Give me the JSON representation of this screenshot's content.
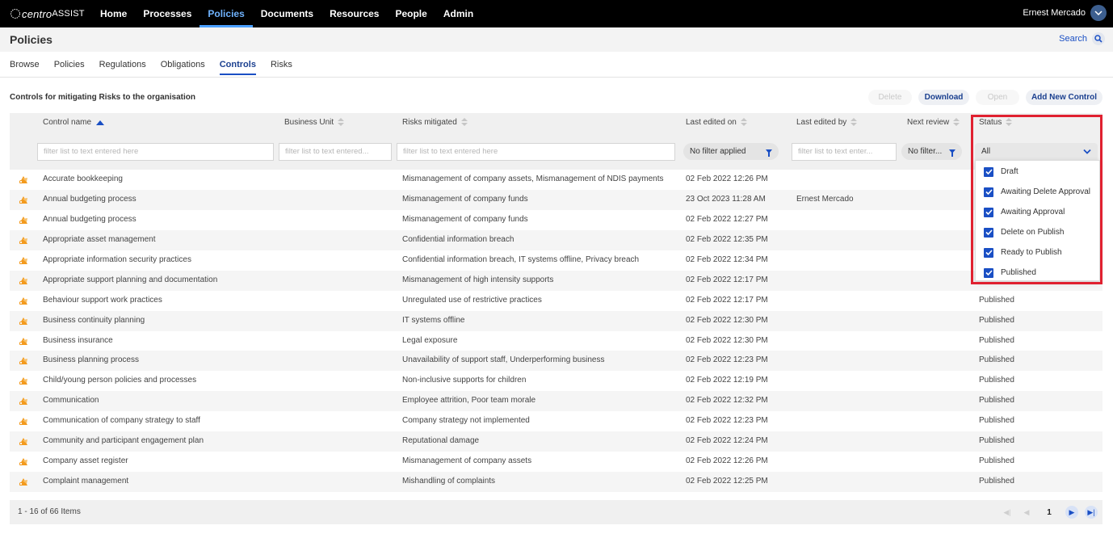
{
  "topnav": {
    "logo_prefix": "centro",
    "logo_suffix": "ASSIST",
    "items": [
      {
        "label": "Home",
        "active": false
      },
      {
        "label": "Processes",
        "active": false
      },
      {
        "label": "Policies",
        "active": true
      },
      {
        "label": "Documents",
        "active": false
      },
      {
        "label": "Resources",
        "active": false
      },
      {
        "label": "People",
        "active": false
      },
      {
        "label": "Admin",
        "active": false
      }
    ],
    "user_name": "Ernest Mercado"
  },
  "page": {
    "title": "Policies",
    "search_label": "Search"
  },
  "subtabs": [
    {
      "label": "Browse",
      "active": false
    },
    {
      "label": "Policies",
      "active": false
    },
    {
      "label": "Regulations",
      "active": false
    },
    {
      "label": "Obligations",
      "active": false
    },
    {
      "label": "Controls",
      "active": true
    },
    {
      "label": "Risks",
      "active": false
    }
  ],
  "toolbar": {
    "caption": "Controls for mitigating Risks to the organisation",
    "delete_label": "Delete",
    "download_label": "Download",
    "open_label": "Open",
    "add_label": "Add New Control"
  },
  "grid": {
    "columns": {
      "control_name": "Control name",
      "business_unit": "Business Unit",
      "risks_mitigated": "Risks mitigated",
      "last_edited_on": "Last edited on",
      "last_edited_by": "Last edited by",
      "next_review": "Next review",
      "status": "Status"
    },
    "filters": {
      "control_name_placeholder": "filter list to text entered here",
      "business_unit_placeholder": "filter list to text entered...",
      "risks_placeholder": "filter list to text entered here",
      "last_edited_on_value": "No filter applied",
      "last_edited_by_placeholder": "filter list to text enter...",
      "next_review_value": "No filter...",
      "status_value": "All"
    },
    "rows": [
      {
        "name": "Accurate bookkeeping",
        "unit": "",
        "risks": "Mismanagement of company assets, Mismanagement of NDIS payments",
        "edited_on": "02 Feb 2022 12:26 PM",
        "edited_by": "",
        "next_review": "",
        "status": ""
      },
      {
        "name": "Annual budgeting process",
        "unit": "",
        "risks": "Mismanagement of company funds",
        "edited_on": "23 Oct 2023 11:28 AM",
        "edited_by": "Ernest Mercado",
        "next_review": "",
        "status": ""
      },
      {
        "name": "Annual budgeting process",
        "unit": "",
        "risks": "Mismanagement of company funds",
        "edited_on": "02 Feb 2022 12:27 PM",
        "edited_by": "",
        "next_review": "",
        "status": ""
      },
      {
        "name": "Appropriate asset management",
        "unit": "",
        "risks": "Confidential information breach",
        "edited_on": "02 Feb 2022 12:35 PM",
        "edited_by": "",
        "next_review": "",
        "status": ""
      },
      {
        "name": "Appropriate information security practices",
        "unit": "",
        "risks": "Confidential information breach, IT systems offline, Privacy breach",
        "edited_on": "02 Feb 2022 12:34 PM",
        "edited_by": "",
        "next_review": "",
        "status": ""
      },
      {
        "name": "Appropriate support planning and documentation",
        "unit": "",
        "risks": "Mismanagement of high intensity supports",
        "edited_on": "02 Feb 2022 12:17 PM",
        "edited_by": "",
        "next_review": "",
        "status": ""
      },
      {
        "name": "Behaviour support work practices",
        "unit": "",
        "risks": "Unregulated use of restrictive practices",
        "edited_on": "02 Feb 2022 12:17 PM",
        "edited_by": "",
        "next_review": "",
        "status": "Published"
      },
      {
        "name": "Business continuity planning",
        "unit": "",
        "risks": "IT systems offline",
        "edited_on": "02 Feb 2022 12:30 PM",
        "edited_by": "",
        "next_review": "",
        "status": "Published"
      },
      {
        "name": "Business insurance",
        "unit": "",
        "risks": "Legal exposure",
        "edited_on": "02 Feb 2022 12:30 PM",
        "edited_by": "",
        "next_review": "",
        "status": "Published"
      },
      {
        "name": "Business planning process",
        "unit": "",
        "risks": "Unavailability of support staff, Underperforming business",
        "edited_on": "02 Feb 2022 12:23 PM",
        "edited_by": "",
        "next_review": "",
        "status": "Published"
      },
      {
        "name": "Child/young person policies and processes",
        "unit": "",
        "risks": "Non-inclusive supports for children",
        "edited_on": "02 Feb 2022 12:19 PM",
        "edited_by": "",
        "next_review": "",
        "status": "Published"
      },
      {
        "name": "Communication",
        "unit": "",
        "risks": "Employee attrition, Poor team morale",
        "edited_on": "02 Feb 2022 12:32 PM",
        "edited_by": "",
        "next_review": "",
        "status": "Published"
      },
      {
        "name": "Communication of company strategy to staff",
        "unit": "",
        "risks": "Company strategy not implemented",
        "edited_on": "02 Feb 2022 12:23 PM",
        "edited_by": "",
        "next_review": "",
        "status": "Published"
      },
      {
        "name": "Community and participant engagement plan",
        "unit": "",
        "risks": "Reputational damage",
        "edited_on": "02 Feb 2022 12:24 PM",
        "edited_by": "",
        "next_review": "",
        "status": "Published"
      },
      {
        "name": "Company asset register",
        "unit": "",
        "risks": "Mismanagement of company assets",
        "edited_on": "02 Feb 2022 12:26 PM",
        "edited_by": "",
        "next_review": "",
        "status": "Published"
      },
      {
        "name": "Complaint management",
        "unit": "",
        "risks": "Mishandling of complaints",
        "edited_on": "02 Feb 2022 12:25 PM",
        "edited_by": "",
        "next_review": "",
        "status": "Published"
      }
    ],
    "footer": {
      "count_text": "1 - 16 of 66 Items",
      "current_page": "1"
    }
  },
  "status_dropdown": {
    "options": [
      {
        "label": "Draft",
        "checked": true
      },
      {
        "label": "Awaiting Delete Approval",
        "checked": true
      },
      {
        "label": "Awaiting Approval",
        "checked": true
      },
      {
        "label": "Delete on Publish",
        "checked": true
      },
      {
        "label": "Ready to Publish",
        "checked": true
      },
      {
        "label": "Published",
        "checked": true
      }
    ]
  },
  "colors": {
    "accent": "#1a4fc4",
    "nav_bg": "#000000",
    "highlight": "#e02130",
    "row_icon": "#f39a1d"
  }
}
